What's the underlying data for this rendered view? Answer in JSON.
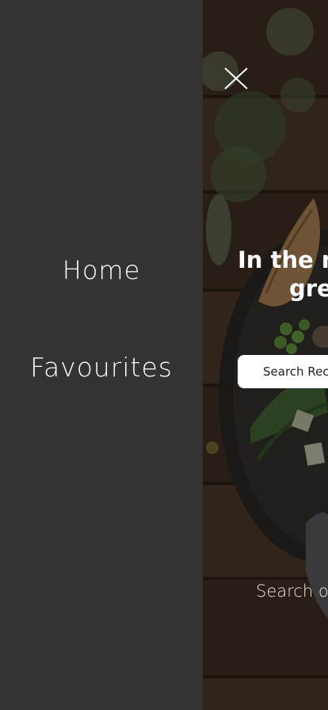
{
  "drawer": {
    "items": [
      {
        "label": "Home"
      },
      {
        "label": "Favourites"
      }
    ]
  },
  "hero": {
    "title_line1": "In the m",
    "title_line2": "gre"
  },
  "search": {
    "placeholder": "Search Rec"
  },
  "footer": {
    "text": "Search ov"
  },
  "colors": {
    "drawer_bg": "#343233",
    "text": "#ffffff"
  },
  "icons": {
    "close": "close-icon"
  }
}
